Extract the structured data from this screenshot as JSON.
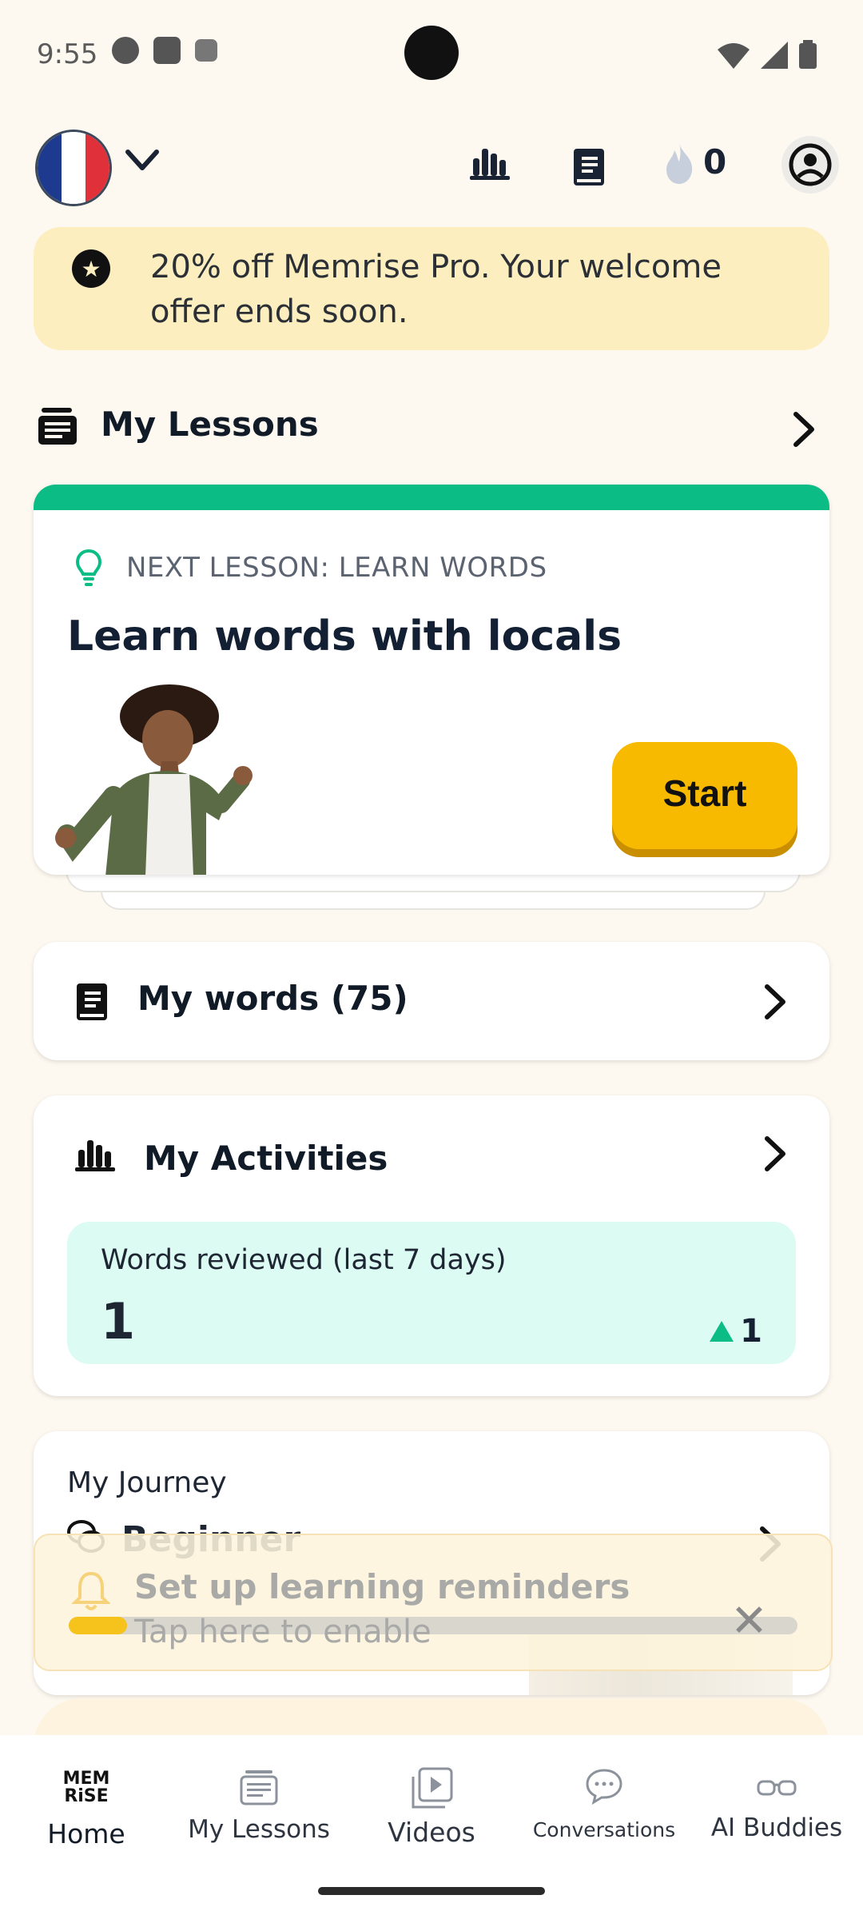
{
  "status_bar": {
    "time": "9:55"
  },
  "header": {
    "streak_count": "0"
  },
  "promo": {
    "text": "20% off Memrise Pro. Your welcome offer ends soon."
  },
  "my_lessons": {
    "title": "My Lessons"
  },
  "lesson_card": {
    "next_label": "NEXT LESSON: LEARN WORDS",
    "title": "Learn words with locals",
    "start_label": "Start"
  },
  "my_words": {
    "label": "My words (75)"
  },
  "activities": {
    "title": "My Activities",
    "stat_label": "Words reviewed (last 7 days)",
    "stat_value": "1",
    "stat_delta": "1"
  },
  "journey": {
    "title": "My Journey",
    "level": "Beginner"
  },
  "reminder_toast": {
    "title": "Set up learning reminders",
    "subtitle": "Tap here to enable",
    "progress": 0.08
  },
  "bottom_nav": {
    "logo_text_top": "MEM",
    "logo_text_bottom": "RiSE",
    "items": [
      {
        "label": "Home",
        "icon": "memrise-logo-icon"
      },
      {
        "label": "My Lessons",
        "icon": "lessons-icon"
      },
      {
        "label": "Videos",
        "icon": "videos-icon"
      },
      {
        "label": "Conversations",
        "icon": "chat-icon"
      },
      {
        "label": "AI Buddies",
        "icon": "glasses-icon"
      }
    ]
  },
  "colors": {
    "background": "#fdf9f1",
    "accent_green": "#0bbd85",
    "start_button": "#f8ba00",
    "promo_bg": "#fdeebf",
    "stat_bg": "#dcfbf3"
  }
}
